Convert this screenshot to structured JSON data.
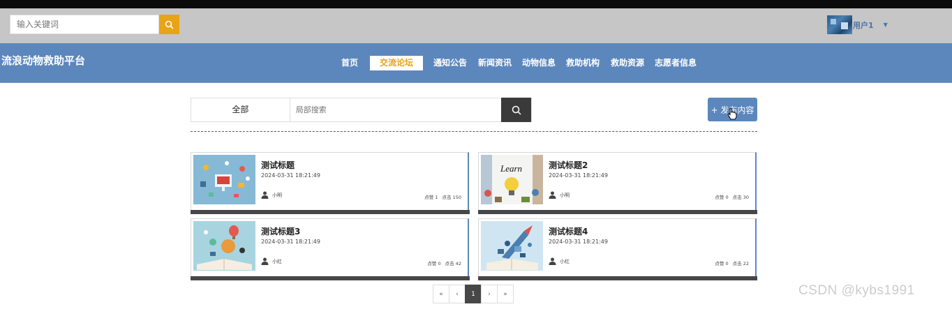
{
  "header": {
    "search_placeholder": "输入关键词",
    "username": "用户1"
  },
  "nav": {
    "logo": "流浪动物救助平台",
    "items": [
      "首页",
      "交流论坛",
      "通知公告",
      "新闻资讯",
      "动物信息",
      "救助机构",
      "救助资源",
      "志愿者信息"
    ],
    "active": "交流论坛"
  },
  "filter": {
    "category": "全部",
    "search_placeholder": "局部搜索"
  },
  "publish_label": "+ 发布内容",
  "posts": [
    {
      "title": "测试标题",
      "date": "2024-03-31 18:21:49",
      "author": "小明",
      "likes": "点赞 1",
      "clicks": "点击 150"
    },
    {
      "title": "测试标题2",
      "date": "2024-03-31 18:21:49",
      "author": "小明",
      "likes": "点赞 0",
      "clicks": "点击 30"
    },
    {
      "title": "测试标题3",
      "date": "2024-03-31 18:21:49",
      "author": "小红",
      "likes": "点赞 0",
      "clicks": "点击 42"
    },
    {
      "title": "测试标题4",
      "date": "2024-03-31 18:21:49",
      "author": "小红",
      "likes": "点赞 0",
      "clicks": "点击 22"
    }
  ],
  "pagination": {
    "first": "«",
    "prev": "‹",
    "current": "1",
    "next": "›",
    "last": "»"
  },
  "watermark": "CSDN @kybs1991",
  "colors": {
    "nav_bg": "#5b87bd",
    "accent": "#e8a317",
    "topbar_bg": "#c6c6c6",
    "card_bottom": "#474747"
  }
}
